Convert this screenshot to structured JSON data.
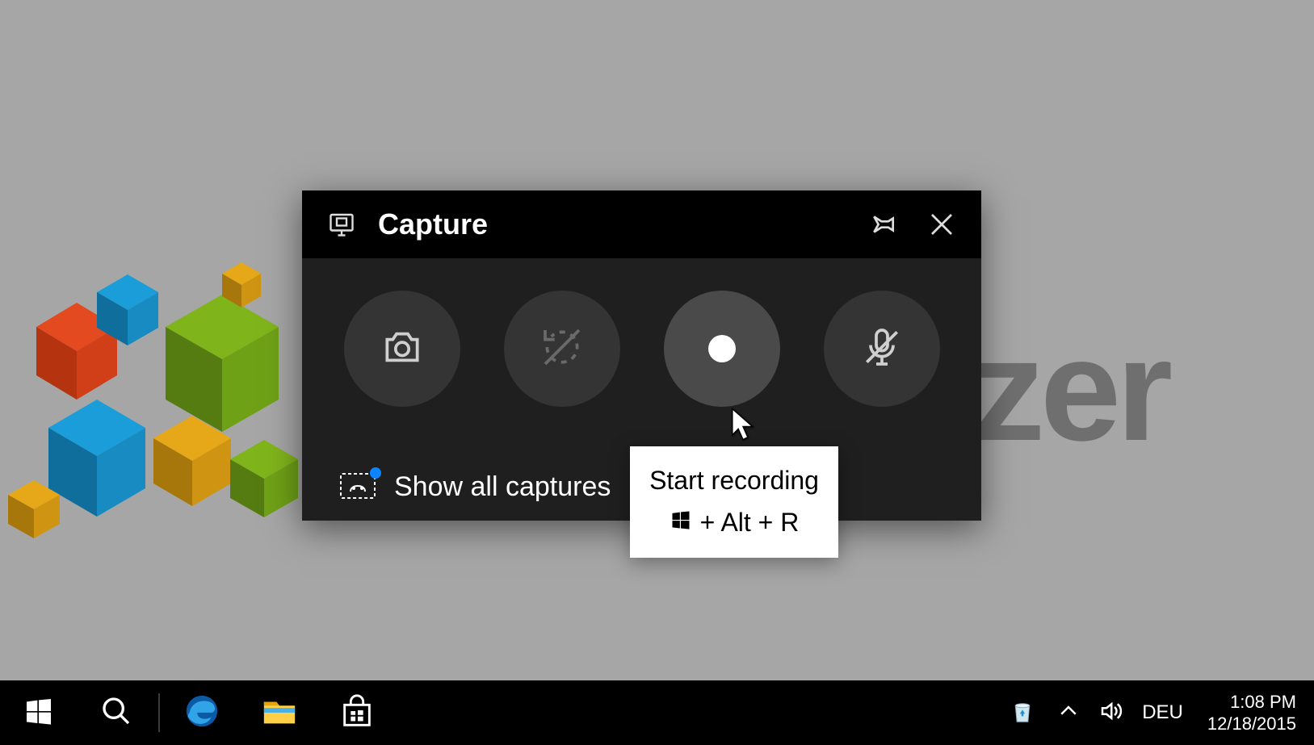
{
  "capture_widget": {
    "title": "Capture",
    "show_all_label": "Show all captures"
  },
  "tooltip": {
    "title": "Start recording",
    "shortcut_suffix": " + Alt + R"
  },
  "taskbar": {
    "ime": "DEU",
    "time": "1:08 PM",
    "date": "12/18/2015"
  },
  "background": {
    "partial_text": "zzer"
  }
}
